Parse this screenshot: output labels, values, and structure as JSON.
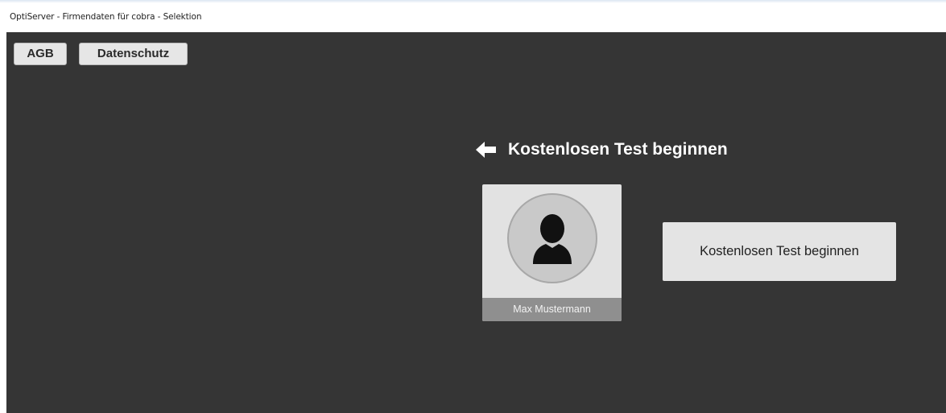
{
  "window": {
    "title": "OptiServer - Firmendaten für cobra - Selektion"
  },
  "toolbar": {
    "agb_label": "AGB",
    "datenschutz_label": "Datenschutz"
  },
  "main": {
    "heading": "Kostenlosen Test beginnen",
    "heading_icon": "arrow-left-icon",
    "user_card": {
      "name": "Max Mustermann",
      "icon": "user-silhouette-icon"
    },
    "start_button_label": "Kostenlosen Test beginnen"
  },
  "colors": {
    "background": "#353535",
    "card": "#e2e2e2",
    "name_bar": "#8f8f8f",
    "heading_text": "#ffffff"
  }
}
